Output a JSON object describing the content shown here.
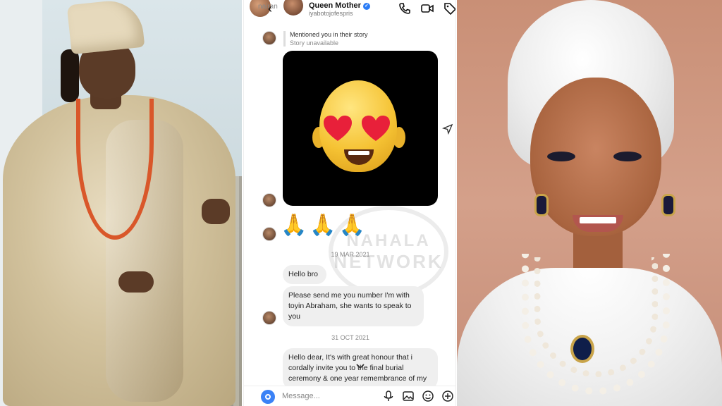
{
  "header": {
    "overlay_text": "nairan",
    "back_icon": "chevron-left-icon",
    "name": "Queen Mother",
    "handle": "iyabotojofespris",
    "verified": true,
    "icons": [
      "phone-icon",
      "video-icon",
      "tag-icon"
    ]
  },
  "story_note": {
    "line1": "Mentioned you in their story",
    "line2": "Story unavailable"
  },
  "story_image": {
    "description_icon": "heart-eyes-memoji-icon"
  },
  "reaction": {
    "emojis": "🙏🙏🙏"
  },
  "watermark": {
    "line1": "NAHALA",
    "line2": "NETWORK"
  },
  "dates": {
    "first": "19 MAR 2021",
    "second": "31 OCT 2021"
  },
  "messages": [
    {
      "text": "Hello bro"
    },
    {
      "text": "Please send me you number I'm with toyin Abraham, she wants to speak to you"
    },
    {
      "text": "Hello dear,  It's with great honour that i cordally invite you to the final burial ceremony & one year remembrance of my dearly beloved mother"
    }
  ],
  "composer": {
    "placeholder": "Message...",
    "icons": [
      "camera-icon",
      "microphone-icon",
      "image-icon",
      "sticker-icon",
      "add-icon"
    ]
  },
  "colors": {
    "accent": "#3b82f6",
    "bubble": "#efefef",
    "verified": "#2a7cf6"
  }
}
